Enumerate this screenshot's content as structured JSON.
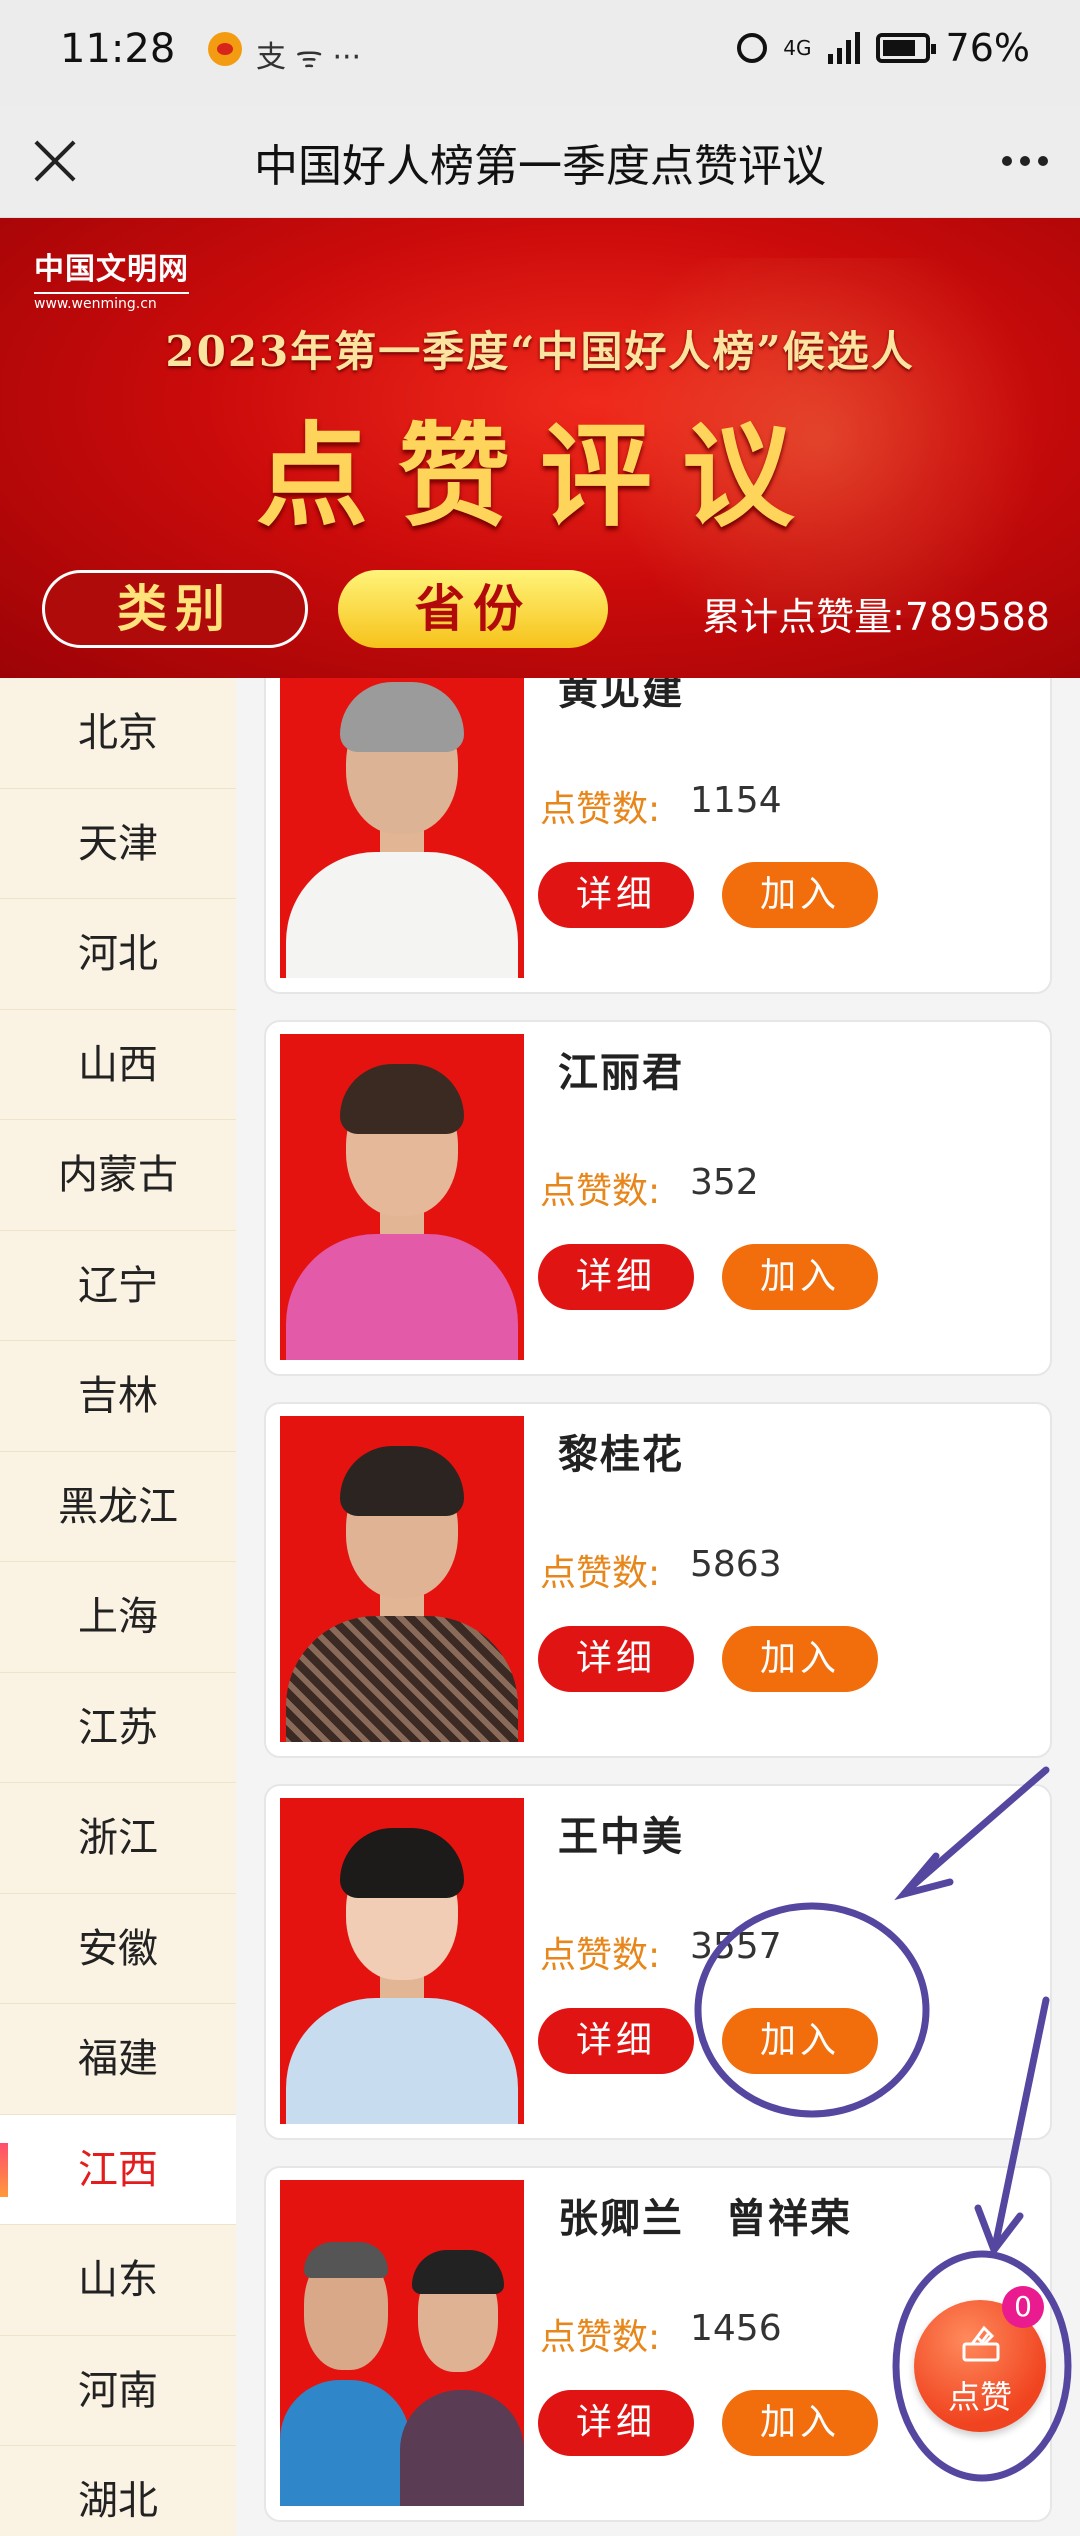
{
  "status_bar": {
    "time": "11:28",
    "left_icons": "支 ᯤ ···",
    "network": "4G",
    "battery": "76%"
  },
  "title_bar": {
    "title": "中国好人榜第一季度点赞评议"
  },
  "banner": {
    "logo": "中国文明网",
    "logo_url": "www.wenming.cn",
    "headline": "2023年第一季度“中国好人榜”候选人",
    "title": "点赞评议",
    "tabs": [
      "类别",
      "省份"
    ],
    "total_likes": "累计点赞量:789588"
  },
  "sidebar": {
    "active": "江西",
    "provinces": [
      "北京",
      "天津",
      "河北",
      "山西",
      "内蒙古",
      "辽宁",
      "吉林",
      "黑龙江",
      "上海",
      "江苏",
      "浙江",
      "安徽",
      "福建",
      "江西",
      "山东",
      "河南",
      "湖北"
    ]
  },
  "candidates": [
    {
      "name": "黄见建",
      "likes_label": "点赞数:",
      "likes": "1154",
      "detail": "详细",
      "join": "加入"
    },
    {
      "name": "江丽君",
      "likes_label": "点赞数:",
      "likes": "352",
      "detail": "详细",
      "join": "加入"
    },
    {
      "name": "黎桂花",
      "likes_label": "点赞数:",
      "likes": "5863",
      "detail": "详细",
      "join": "加入"
    },
    {
      "name": "王中美",
      "likes_label": "点赞数:",
      "likes": "3557",
      "detail": "详细",
      "join": "加入"
    },
    {
      "name": "张卿兰　曾祥荣",
      "likes_label": "点赞数:",
      "likes": "1456",
      "detail": "详细",
      "join": "加入"
    }
  ],
  "vote_button": {
    "label": "点赞",
    "badge": "0"
  },
  "colors": {
    "accent": "#e11414",
    "join": "#f26d0c",
    "likes_label": "#e7861a",
    "annotation": "#5546a0"
  }
}
